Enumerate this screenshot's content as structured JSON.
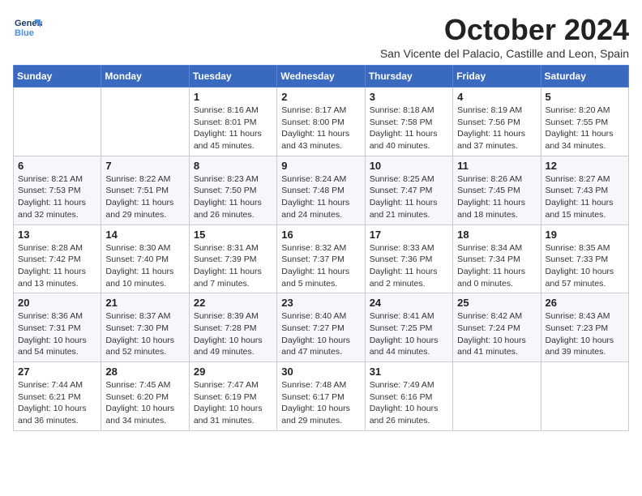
{
  "header": {
    "logo": {
      "line1": "General",
      "line2": "Blue"
    },
    "title": "October 2024",
    "subtitle": "San Vicente del Palacio, Castille and Leon, Spain"
  },
  "weekdays": [
    "Sunday",
    "Monday",
    "Tuesday",
    "Wednesday",
    "Thursday",
    "Friday",
    "Saturday"
  ],
  "weeks": [
    [
      null,
      null,
      {
        "day": "1",
        "sunrise": "Sunrise: 8:16 AM",
        "sunset": "Sunset: 8:01 PM",
        "daylight": "Daylight: 11 hours and 45 minutes."
      },
      {
        "day": "2",
        "sunrise": "Sunrise: 8:17 AM",
        "sunset": "Sunset: 8:00 PM",
        "daylight": "Daylight: 11 hours and 43 minutes."
      },
      {
        "day": "3",
        "sunrise": "Sunrise: 8:18 AM",
        "sunset": "Sunset: 7:58 PM",
        "daylight": "Daylight: 11 hours and 40 minutes."
      },
      {
        "day": "4",
        "sunrise": "Sunrise: 8:19 AM",
        "sunset": "Sunset: 7:56 PM",
        "daylight": "Daylight: 11 hours and 37 minutes."
      },
      {
        "day": "5",
        "sunrise": "Sunrise: 8:20 AM",
        "sunset": "Sunset: 7:55 PM",
        "daylight": "Daylight: 11 hours and 34 minutes."
      }
    ],
    [
      {
        "day": "6",
        "sunrise": "Sunrise: 8:21 AM",
        "sunset": "Sunset: 7:53 PM",
        "daylight": "Daylight: 11 hours and 32 minutes."
      },
      {
        "day": "7",
        "sunrise": "Sunrise: 8:22 AM",
        "sunset": "Sunset: 7:51 PM",
        "daylight": "Daylight: 11 hours and 29 minutes."
      },
      {
        "day": "8",
        "sunrise": "Sunrise: 8:23 AM",
        "sunset": "Sunset: 7:50 PM",
        "daylight": "Daylight: 11 hours and 26 minutes."
      },
      {
        "day": "9",
        "sunrise": "Sunrise: 8:24 AM",
        "sunset": "Sunset: 7:48 PM",
        "daylight": "Daylight: 11 hours and 24 minutes."
      },
      {
        "day": "10",
        "sunrise": "Sunrise: 8:25 AM",
        "sunset": "Sunset: 7:47 PM",
        "daylight": "Daylight: 11 hours and 21 minutes."
      },
      {
        "day": "11",
        "sunrise": "Sunrise: 8:26 AM",
        "sunset": "Sunset: 7:45 PM",
        "daylight": "Daylight: 11 hours and 18 minutes."
      },
      {
        "day": "12",
        "sunrise": "Sunrise: 8:27 AM",
        "sunset": "Sunset: 7:43 PM",
        "daylight": "Daylight: 11 hours and 15 minutes."
      }
    ],
    [
      {
        "day": "13",
        "sunrise": "Sunrise: 8:28 AM",
        "sunset": "Sunset: 7:42 PM",
        "daylight": "Daylight: 11 hours and 13 minutes."
      },
      {
        "day": "14",
        "sunrise": "Sunrise: 8:30 AM",
        "sunset": "Sunset: 7:40 PM",
        "daylight": "Daylight: 11 hours and 10 minutes."
      },
      {
        "day": "15",
        "sunrise": "Sunrise: 8:31 AM",
        "sunset": "Sunset: 7:39 PM",
        "daylight": "Daylight: 11 hours and 7 minutes."
      },
      {
        "day": "16",
        "sunrise": "Sunrise: 8:32 AM",
        "sunset": "Sunset: 7:37 PM",
        "daylight": "Daylight: 11 hours and 5 minutes."
      },
      {
        "day": "17",
        "sunrise": "Sunrise: 8:33 AM",
        "sunset": "Sunset: 7:36 PM",
        "daylight": "Daylight: 11 hours and 2 minutes."
      },
      {
        "day": "18",
        "sunrise": "Sunrise: 8:34 AM",
        "sunset": "Sunset: 7:34 PM",
        "daylight": "Daylight: 11 hours and 0 minutes."
      },
      {
        "day": "19",
        "sunrise": "Sunrise: 8:35 AM",
        "sunset": "Sunset: 7:33 PM",
        "daylight": "Daylight: 10 hours and 57 minutes."
      }
    ],
    [
      {
        "day": "20",
        "sunrise": "Sunrise: 8:36 AM",
        "sunset": "Sunset: 7:31 PM",
        "daylight": "Daylight: 10 hours and 54 minutes."
      },
      {
        "day": "21",
        "sunrise": "Sunrise: 8:37 AM",
        "sunset": "Sunset: 7:30 PM",
        "daylight": "Daylight: 10 hours and 52 minutes."
      },
      {
        "day": "22",
        "sunrise": "Sunrise: 8:39 AM",
        "sunset": "Sunset: 7:28 PM",
        "daylight": "Daylight: 10 hours and 49 minutes."
      },
      {
        "day": "23",
        "sunrise": "Sunrise: 8:40 AM",
        "sunset": "Sunset: 7:27 PM",
        "daylight": "Daylight: 10 hours and 47 minutes."
      },
      {
        "day": "24",
        "sunrise": "Sunrise: 8:41 AM",
        "sunset": "Sunset: 7:25 PM",
        "daylight": "Daylight: 10 hours and 44 minutes."
      },
      {
        "day": "25",
        "sunrise": "Sunrise: 8:42 AM",
        "sunset": "Sunset: 7:24 PM",
        "daylight": "Daylight: 10 hours and 41 minutes."
      },
      {
        "day": "26",
        "sunrise": "Sunrise: 8:43 AM",
        "sunset": "Sunset: 7:23 PM",
        "daylight": "Daylight: 10 hours and 39 minutes."
      }
    ],
    [
      {
        "day": "27",
        "sunrise": "Sunrise: 7:44 AM",
        "sunset": "Sunset: 6:21 PM",
        "daylight": "Daylight: 10 hours and 36 minutes."
      },
      {
        "day": "28",
        "sunrise": "Sunrise: 7:45 AM",
        "sunset": "Sunset: 6:20 PM",
        "daylight": "Daylight: 10 hours and 34 minutes."
      },
      {
        "day": "29",
        "sunrise": "Sunrise: 7:47 AM",
        "sunset": "Sunset: 6:19 PM",
        "daylight": "Daylight: 10 hours and 31 minutes."
      },
      {
        "day": "30",
        "sunrise": "Sunrise: 7:48 AM",
        "sunset": "Sunset: 6:17 PM",
        "daylight": "Daylight: 10 hours and 29 minutes."
      },
      {
        "day": "31",
        "sunrise": "Sunrise: 7:49 AM",
        "sunset": "Sunset: 6:16 PM",
        "daylight": "Daylight: 10 hours and 26 minutes."
      },
      null,
      null
    ]
  ]
}
